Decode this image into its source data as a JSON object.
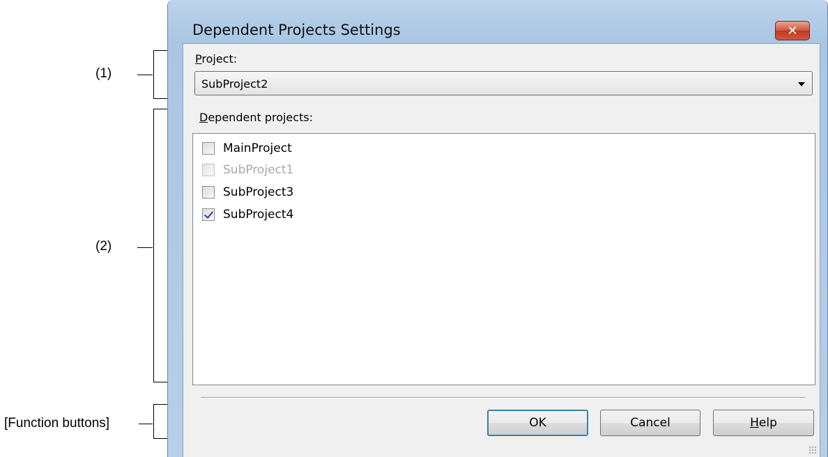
{
  "annotations": {
    "label_1": "(1)",
    "label_2": "(2)",
    "label_function_buttons": "[Function buttons]"
  },
  "window": {
    "title": "Dependent Projects Settings",
    "close_icon": "close-icon"
  },
  "project": {
    "label_accel": "P",
    "label_rest": "roject:",
    "selected_value": "SubProject2"
  },
  "dependent": {
    "label_accel": "D",
    "label_rest": "ependent projects:",
    "items": [
      {
        "label": "MainProject",
        "checked": false,
        "enabled": true
      },
      {
        "label": "SubProject1",
        "checked": false,
        "enabled": false
      },
      {
        "label": "SubProject3",
        "checked": false,
        "enabled": true
      },
      {
        "label": "SubProject4",
        "checked": true,
        "enabled": true
      }
    ]
  },
  "buttons": {
    "ok": "OK",
    "cancel": "Cancel",
    "help_accel": "H",
    "help_rest": "elp"
  },
  "colors": {
    "title_bar": "#a9c6e4",
    "client_bg": "#f0f0f0",
    "close_button": "#c1361f",
    "default_button_border": "#3c7fb1",
    "disabled_text": "#a8a8a8"
  }
}
